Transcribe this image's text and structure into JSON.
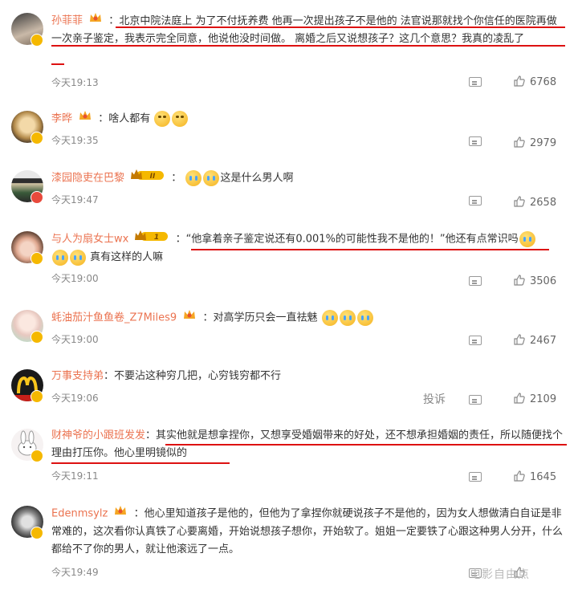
{
  "comments": [
    {
      "user": "孙菲菲",
      "body_pre": "：",
      "body_hl": "北京中院法庭上 为了不付抚养费 他再一次提出孩子不是他的 法官说那就找个你信任的医院再做一次亲子鉴定，我表示完全同意，他说他没时间做。 离婚之后又说想孩子？这几个意思？我真的凌乱了",
      "body_post": "",
      "time": "今天19:13",
      "likes": "6768",
      "badge": "gold"
    },
    {
      "user": "李晔",
      "body_pre": "：啥人都有",
      "body_hl": "",
      "body_post": "",
      "time": "今天19:35",
      "likes": "2979",
      "badge": "gold"
    },
    {
      "user": "漆园隐吏在巴黎",
      "body_pre": "：",
      "body_hl": "",
      "body_post": "这是什么男人啊",
      "time": "今天19:47",
      "likes": "2658",
      "badge": "red",
      "level": "II"
    },
    {
      "user": "与人为扇女士wx",
      "body_pre": "：",
      "body_hl": "“他拿着亲子鉴定说还有0.001%的可能性我不是他的！”他还有点常识吗",
      "body_post": "真有这样的人嘛",
      "time": "今天19:00",
      "likes": "3506",
      "badge": "gold",
      "level": "1"
    },
    {
      "user": "蚝油茄汁鱼鱼卷_Z7Miles9",
      "body_pre": "：对高学历只会一直祛魅",
      "body_hl": "",
      "body_post": "",
      "time": "今天19:00",
      "likes": "2467",
      "badge": "gold"
    },
    {
      "user": "万事支持弟",
      "body_pre": "：不要沾这种穷几把，心穷钱穷都不行",
      "body_hl": "",
      "body_post": "",
      "time": "今天19:06",
      "likes": "2109",
      "badge": "gold",
      "report": "投诉"
    },
    {
      "user": "财神爷的小跟班发发",
      "body_pre": "：",
      "body_hl": "其实他就是想拿捏你，又想享受婚姻带来的好处，还不想承担婚姻的责任，所以随便找个理由打压你。他心里明镜似的",
      "body_post": "",
      "time": "今天19:11",
      "likes": "1645",
      "badge": "gold"
    },
    {
      "user": "Edenmsylz",
      "body_pre": "：他心里知道孩子是他的，但他为了拿捏你就硬说孩子不是他的，因为女人想做清白自证是非常难的，这次看你认真铁了心要离婚，开始说想孩子想你，开始软了。姐姐一定要铁了心跟这种男人分开，什么都给不了你的男人，就让他滚远了一点。",
      "body_hl": "",
      "body_post": "",
      "time": "今天19:49",
      "likes": "",
      "badge": "gold"
    }
  ],
  "watermark": "电影自由点"
}
